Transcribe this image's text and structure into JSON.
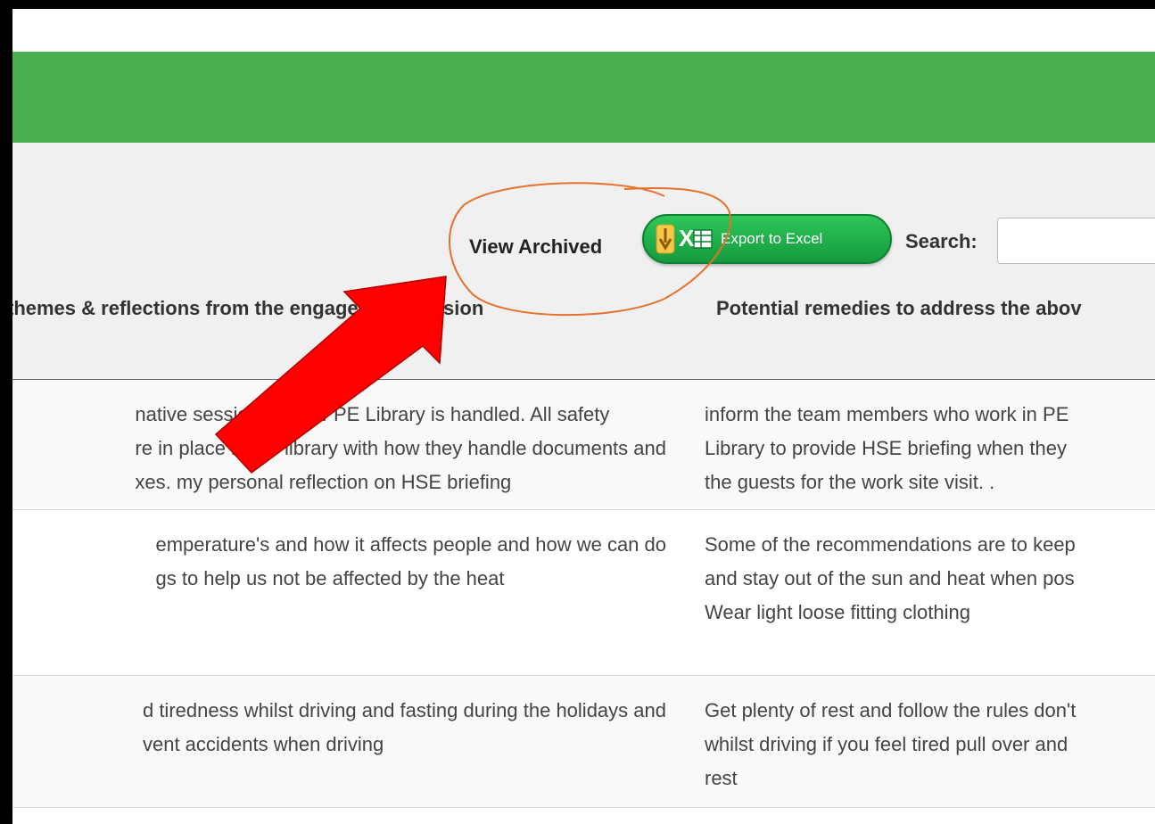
{
  "toolbar": {
    "view_archived": "View Archived",
    "export_label": "Export to Excel",
    "export_icon_letter": "X",
    "search_label": "Search:",
    "search_value": ""
  },
  "table": {
    "headers": [
      "themes & reflections from the engagement session",
      "Potential remedies to address the abov"
    ],
    "rows": [
      {
        "left": "native session on how PE Library is handled. All safety\nre in place in the library with how they handle documents and\nxes. my personal reflection on HSE briefing",
        "right": "inform the team members who work in PE \nLibrary to provide HSE briefing when they \nthe guests for the work site visit. ."
      },
      {
        "left": "emperature's and how it affects people and how we can do\ngs to help us not be affected by the heat",
        "right": "Some of the recommendations are to keep\nand stay out of the sun and heat when pos\nWear light loose fitting clothing"
      },
      {
        "left": "d tiredness whilst driving and fasting during the holidays and\nvent accidents when driving",
        "right": "Get plenty of rest and follow the rules don't\nwhilst driving if you feel tired pull over and \nrest"
      }
    ]
  },
  "colors": {
    "header_green": "#4caf50",
    "export_green": "#1fae4b",
    "annotation_red": "#ff0000",
    "annotation_orange": "#e8702a"
  },
  "icons": {
    "export": "excel-export-icon",
    "annotation_arrow": "red-arrow-annotation",
    "annotation_circle": "orange-circle-annotation"
  }
}
